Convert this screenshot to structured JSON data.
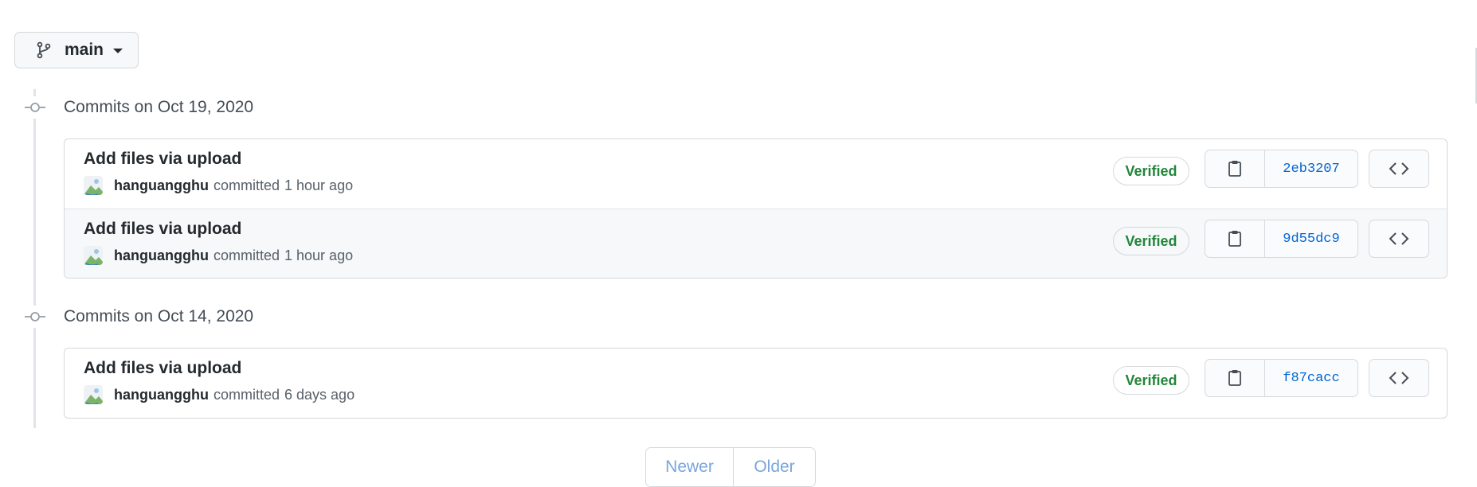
{
  "branch": {
    "name": "main",
    "icon": "git-branch-icon"
  },
  "groups": [
    {
      "date_label": "Commits on Oct 19, 2020",
      "commits": [
        {
          "title": "Add files via upload",
          "author": "hanguangghu",
          "action": "committed",
          "time": "1 hour ago",
          "verified": "Verified",
          "sha": "2eb3207"
        },
        {
          "title": "Add files via upload",
          "author": "hanguangghu",
          "action": "committed",
          "time": "1 hour ago",
          "verified": "Verified",
          "sha": "9d55dc9"
        }
      ]
    },
    {
      "date_label": "Commits on Oct 14, 2020",
      "commits": [
        {
          "title": "Add files via upload",
          "author": "hanguangghu",
          "action": "committed",
          "time": "6 days ago",
          "verified": "Verified",
          "sha": "f87cacc"
        }
      ]
    }
  ],
  "pagination": {
    "newer": "Newer",
    "older": "Older"
  },
  "colors": {
    "verified": "#22863a",
    "sha_link": "#0366d6",
    "pagination_disabled": "#79a6dc",
    "border": "#d5d8dc"
  }
}
